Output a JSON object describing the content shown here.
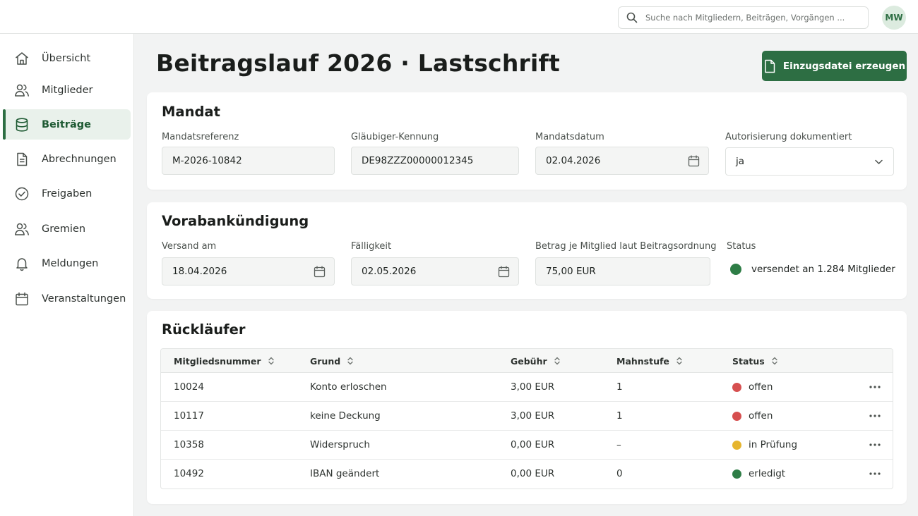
{
  "header": {
    "search_placeholder": "Suche nach Mitgliedern, Beiträgen, Vorgängen ...",
    "avatar_initials": "MW"
  },
  "sidebar": {
    "items": [
      {
        "label": "Übersicht",
        "icon": "home-icon",
        "active": false
      },
      {
        "label": "Mitglieder",
        "icon": "users-icon",
        "active": false
      },
      {
        "label": "Beiträge",
        "icon": "database-icon",
        "active": true
      },
      {
        "label": "Abrechnungen",
        "icon": "document-icon",
        "active": false
      },
      {
        "label": "Freigaben",
        "icon": "check-circle-icon",
        "active": false
      },
      {
        "label": "Gremien",
        "icon": "group-icon",
        "active": false
      },
      {
        "label": "Meldungen",
        "icon": "bell-icon",
        "active": false
      },
      {
        "label": "Veranstaltungen",
        "icon": "calendar-icon",
        "active": false
      }
    ]
  },
  "page": {
    "title": "Beitragslauf 2026 · Lastschrift",
    "primary_button": "Einzugsdatei erzeugen"
  },
  "mandat": {
    "title": "Mandat",
    "mandatsreferenz_label": "Mandatsreferenz",
    "mandatsreferenz_value": "M-2026-10842",
    "glaeubiger_label": "Gläubiger-Kennung",
    "glaeubiger_value": "DE98ZZZ00000012345",
    "mandatsdatum_label": "Mandatsdatum",
    "mandatsdatum_value": "02.04.2026",
    "autorisierung_label": "Autorisierung dokumentiert",
    "autorisierung_value": "ja"
  },
  "vorab": {
    "title": "Vorabankündigung",
    "versand_label": "Versand am",
    "versand_value": "18.04.2026",
    "faelligkeit_label": "Fälligkeit",
    "faelligkeit_value": "02.05.2026",
    "betrag_label": "Betrag je Mitglied laut Beitragsordnung",
    "betrag_value": "75,00 EUR",
    "status_label": "Status",
    "status_value": "versendet an 1.284 Mitglieder",
    "status_color": "#2e7d46"
  },
  "ruecklaeufer": {
    "title": "Rückläufer",
    "columns": [
      "Mitgliedsnummer",
      "Grund",
      "Gebühr",
      "Mahnstufe",
      "Status"
    ],
    "rows": [
      {
        "nr": "10024",
        "grund": "Konto erloschen",
        "gebuehr": "3,00 EUR",
        "mahnstufe": "1",
        "status": "offen",
        "color": "#d64f4f"
      },
      {
        "nr": "10117",
        "grund": "keine Deckung",
        "gebuehr": "3,00 EUR",
        "mahnstufe": "1",
        "status": "offen",
        "color": "#d64f4f"
      },
      {
        "nr": "10358",
        "grund": "Widerspruch",
        "gebuehr": "0,00 EUR",
        "mahnstufe": "–",
        "status": "in Prüfung",
        "color": "#e6b52e"
      },
      {
        "nr": "10492",
        "grund": "IBAN geändert",
        "gebuehr": "0,00 EUR",
        "mahnstufe": "0",
        "status": "erledigt",
        "color": "#2e7d46"
      }
    ]
  },
  "colors": {
    "accent": "#2d6e43",
    "active_bg": "#e9f1eb"
  }
}
